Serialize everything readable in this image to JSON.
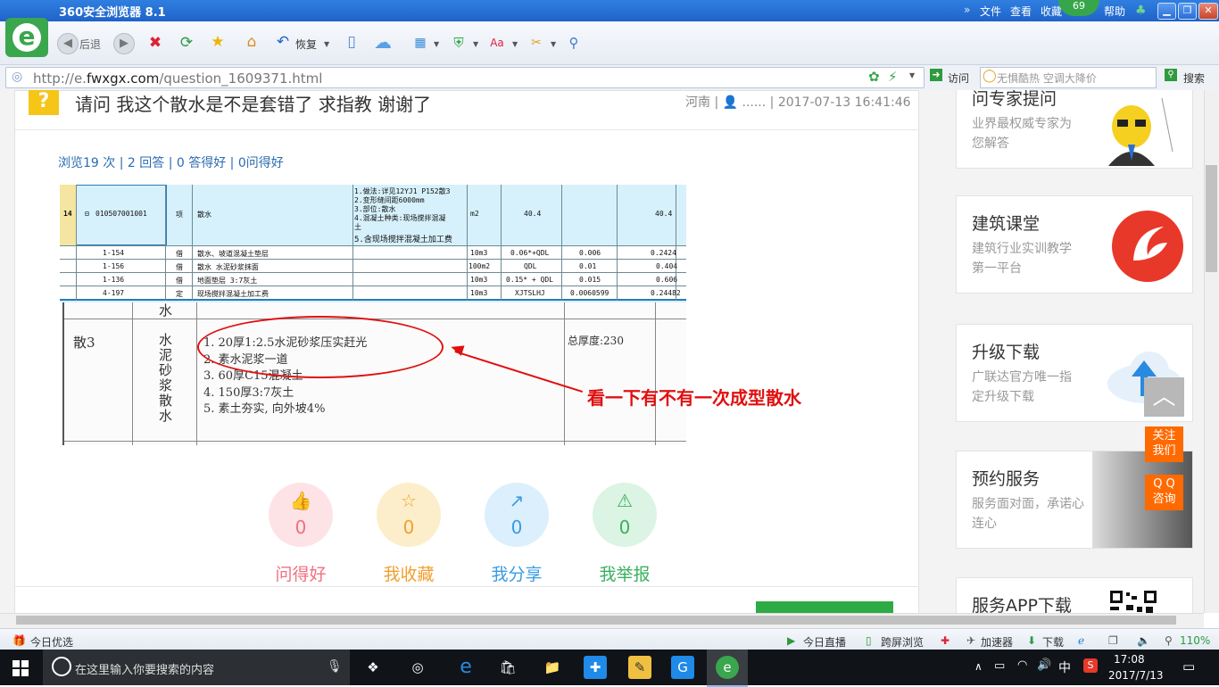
{
  "browser": {
    "title": "360安全浏览器 8.1",
    "menu": [
      "文件",
      "查看",
      "收藏",
      "帮助"
    ],
    "badge_count": "69",
    "toolbar": {
      "back_label": "后退",
      "restore_label": "恢复"
    },
    "url_prefix": "http://e.",
    "url_domain": "fwxgx.com",
    "url_path": "/question_1609371.html",
    "visit_label": "访问",
    "search_placeholder": "无惧酷热 空调大降价",
    "search_button": "搜索"
  },
  "question": {
    "title": "请问 我这个散水是不是套错了 求指教 谢谢了",
    "meta": "河南 | 👤 ...... | 2017-07-13 16:41:46",
    "stats": "浏览19 次 | 2 回答 | 0 答得好 | 0问得好"
  },
  "sheet": {
    "main_row": {
      "no": "14",
      "code": "010507001001",
      "kind": "项",
      "name": "散水",
      "desc": [
        "1.做法:详见12YJ1 P152散3",
        "2.变形缝间距6000mm",
        "3.部位:散水",
        "4.混凝土种类:现场搅拌混凝",
        "土",
        "5.含现场搅拌混凝土加工费"
      ],
      "unit": "m2",
      "qty": "40.4",
      "total": "40.4"
    },
    "sub_rows": [
      {
        "code": "1-154",
        "kind": "借",
        "name": "散水、坡道混凝土垫层",
        "unit": "10m3",
        "expr": "0.06*+QDL",
        "coef": "0.006",
        "amount": "0.2424"
      },
      {
        "code": "1-156",
        "kind": "借",
        "name": "散水 水泥砂浆抹面",
        "unit": "100m2",
        "expr": "QDL",
        "coef": "0.01",
        "amount": "0.404"
      },
      {
        "code": "1-136",
        "kind": "借",
        "name": "地面垫层 3:7灰土",
        "unit": "10m3",
        "expr": "0.15* + QDL",
        "coef": "0.015",
        "amount": "0.606"
      },
      {
        "code": "4-197",
        "kind": "定",
        "name": "现场搅拌混凝土加工费",
        "unit": "10m3",
        "expr": "XJTSLHJ",
        "coef": "0.0060599",
        "amount": "0.24482"
      }
    ]
  },
  "scan": {
    "top_char": "水",
    "name": "散3",
    "material": "水泥砂浆散水",
    "steps": [
      "1. 20厚1:2.5水泥砂浆压实赶光",
      "2. 素水泥浆一道",
      "3. 60厚C15混凝土",
      "4. 150厚3:7灰土",
      "5. 素土夯实, 向外坡4%"
    ],
    "total_thickness": "总厚度:230",
    "annotation": "看一下有不有一次成型散水"
  },
  "actions": [
    {
      "label": "问得好",
      "count": "0",
      "icon": "thumbs-up-icon",
      "color": "#f07080",
      "bg": "#fde3e6"
    },
    {
      "label": "我收藏",
      "count": "0",
      "icon": "star-icon",
      "color": "#f0a030",
      "bg": "#fdeecb"
    },
    {
      "label": "我分享",
      "count": "0",
      "icon": "share-icon",
      "color": "#3a9ce0",
      "bg": "#dbeffc"
    },
    {
      "label": "我举报",
      "count": "0",
      "icon": "warning-icon",
      "color": "#3ab060",
      "bg": "#dcf4e3"
    }
  ],
  "sidebar": [
    {
      "title": "问专家提问",
      "desc": "业界最权威专家为您解答"
    },
    {
      "title": "建筑课堂",
      "desc": "建筑行业实训教学第一平台"
    },
    {
      "title": "升级下载",
      "desc": "广联达官方唯一指定升级下载"
    },
    {
      "title": "预约服务",
      "desc": "服务面对面，承诺心连心"
    },
    {
      "title": "服务APP下载",
      "desc": ""
    }
  ],
  "floating": {
    "follow": "关注\n我们",
    "qq": "Q Q\n咨询"
  },
  "statusbar": {
    "left": "今日优选",
    "items": [
      "今日直播",
      "跨屏浏览",
      "加速器",
      "下载"
    ],
    "zoom": "110%"
  },
  "taskbar": {
    "search_placeholder": "在这里输入你要搜索的内容",
    "ime": "中",
    "time": "17:08",
    "date": "2017/7/13"
  }
}
